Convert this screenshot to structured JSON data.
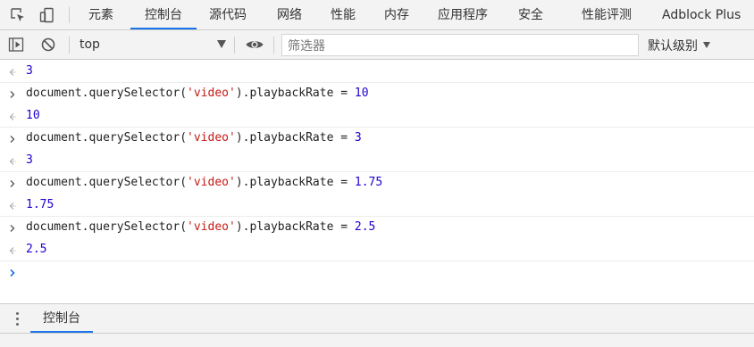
{
  "tabs": [
    {
      "label": "元素",
      "active": false
    },
    {
      "label": "控制台",
      "active": true
    },
    {
      "label": "源代码",
      "active": false
    },
    {
      "label": "网络",
      "active": false
    },
    {
      "label": "性能",
      "active": false
    },
    {
      "label": "内存",
      "active": false
    },
    {
      "label": "应用程序",
      "active": false
    },
    {
      "label": "安全",
      "active": false
    },
    {
      "label": "性能评测",
      "active": false
    },
    {
      "label": "Adblock Plus",
      "active": false
    }
  ],
  "toolbar": {
    "context": "top",
    "filter_placeholder": "筛选器",
    "levels": "默认级别"
  },
  "console": {
    "first_result": "3",
    "entries": [
      {
        "object": "document",
        "method": "querySelector",
        "arg": "'video'",
        "property": "playbackRate",
        "operator": "=",
        "value": "10",
        "result": "10"
      },
      {
        "object": "document",
        "method": "querySelector",
        "arg": "'video'",
        "property": "playbackRate",
        "operator": "=",
        "value": "3",
        "result": "3"
      },
      {
        "object": "document",
        "method": "querySelector",
        "arg": "'video'",
        "property": "playbackRate",
        "operator": "=",
        "value": "1.75",
        "result": "1.75"
      },
      {
        "object": "document",
        "method": "querySelector",
        "arg": "'video'",
        "property": "playbackRate",
        "operator": "=",
        "value": "2.5",
        "result": "2.5"
      }
    ]
  },
  "drawer": {
    "tab": "控制台"
  },
  "colors": {
    "accent": "#1a73e8",
    "number": "#1c00cf",
    "string": "#c41a16",
    "prompt": "#1a73e8"
  }
}
